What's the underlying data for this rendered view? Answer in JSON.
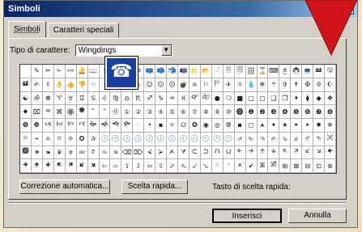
{
  "window": {
    "title": "Simboli",
    "help_button": "?",
    "close_button": "×"
  },
  "tabs": [
    {
      "label": "Simboli",
      "active": true
    },
    {
      "label": "Caratteri speciali",
      "active": false
    }
  ],
  "font": {
    "label": "Tipo di carattere:",
    "value": "Wingdings"
  },
  "grid": {
    "selected_symbol": "☎",
    "rows": [
      [
        "",
        "✎",
        "✂",
        "✁",
        "👓",
        "🔔",
        "📖",
        "🕯",
        "☎",
        "✆",
        "✉",
        "📪",
        "📫",
        "📬",
        "📭",
        "📁",
        "📂",
        "📄",
        "🗏",
        "🗐",
        "🗄",
        "⌛",
        "⌨",
        "🖰",
        "🖲",
        "💻",
        "🖴",
        "🖫"
      ],
      [
        "🖬",
        "✍",
        "✌",
        "👌",
        "👍",
        "👎",
        "☜",
        "☞",
        "☝",
        "☟",
        "✋",
        "☺",
        "😐",
        "☹",
        "💣",
        "☠",
        "⚐",
        "🏱",
        "✈",
        "☼",
        "💧",
        "❄",
        "🕆",
        "✞",
        "🕈",
        "✠",
        "✡",
        "☪"
      ],
      [
        "☯",
        "ॐ",
        "☸",
        "♈",
        "♉",
        "♊",
        "♋",
        "♌",
        "♍",
        "♎",
        "♏",
        "♐",
        "♑",
        "♒",
        "♓",
        "🙰",
        "🙵",
        "●",
        "❍",
        "■",
        "□",
        "◻",
        "❑",
        "❒",
        "⬧",
        "⧫",
        "◆",
        "❖"
      ],
      [
        "⬥",
        "⌧",
        "⮹",
        "⌘",
        "🏵",
        "🏶",
        "🙶",
        "🙷",
        "⓪",
        "①",
        "②",
        "③",
        "④",
        "⑤",
        "⑥",
        "⑦",
        "⑧",
        "⑨",
        "⑩",
        "⓿",
        "❶",
        "❷",
        "❸",
        "❹",
        "❺",
        "❻",
        "❼",
        "❽"
      ],
      [
        "❾",
        "❿",
        "🙢",
        "🙠",
        "🙡",
        "🙣",
        "🙞",
        "🙜",
        "🙝",
        "🙟",
        "·",
        "•",
        "▪",
        "⚪",
        "🞆",
        "🞈",
        "◉",
        "◎",
        "🞋",
        "▪",
        "◻",
        "🟂",
        "✦",
        "★",
        "✶",
        "✴",
        "✹",
        "✵"
      ],
      [
        "⯐",
        "⌖",
        "⟡",
        "⌑",
        "⯑",
        "✪",
        "✰",
        "🕐",
        "🕑",
        "🕒",
        "🕓",
        "🕔",
        "🕕",
        "🕖",
        "🕗",
        "🕘",
        "🕙",
        "🕚",
        "🕛",
        "⮰",
        "⮱",
        "⮲",
        "⮳",
        "⮴",
        "⮵",
        "⮶",
        "⮷",
        "🙪"
      ],
      [
        "🙫",
        "🙕",
        "🙔",
        "🙗",
        "🙖",
        "🙐",
        "🙑",
        "🙒",
        "🙓",
        "⌫",
        "⌦",
        "⮘",
        "⮚",
        "⮙",
        "⮛",
        "⮈",
        "⮊",
        "⮉",
        "⮋",
        "🡨",
        "🡪",
        "🡩",
        "🡫",
        "🡬",
        "🡭",
        "🡯",
        "🡮",
        "🡸"
      ],
      [
        "🡺",
        "🡹",
        "🡻",
        "🡼",
        "🡽",
        "🡿",
        "🡾",
        "⇦",
        "⇨",
        "⇧",
        "⇩",
        "⬄",
        "⇳",
        "⬀",
        "⬁",
        "⬃",
        "⬂",
        "🢬",
        "🢭",
        "🗶",
        "✔",
        "🗷",
        "🗹",
        "⊞",
        "⊠",
        "⊟",
        "⊡",
        "⊛"
      ]
    ]
  },
  "buttons": {
    "autocorrect": "Correzione automatica...",
    "shortcut_key": "Scelta rapida...",
    "shortcut_label": "Tasto di scelta rapida:",
    "insert": "Inserisci",
    "cancel": "Annulla"
  },
  "colors": {
    "annotation_arrow": "#d0141a",
    "selection": "#0a246a"
  }
}
